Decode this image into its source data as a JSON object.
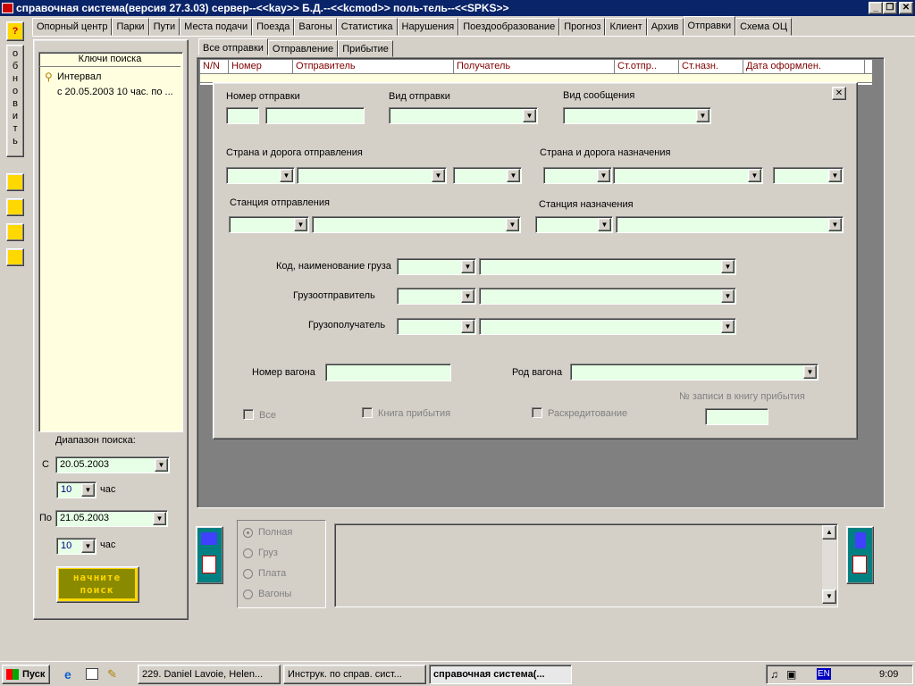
{
  "window": {
    "title": "справочная система(версия 27.3.03) сервер--<<kay>> Б.Д.--<<kcmod>> поль-тель--<<SPKS>>"
  },
  "tabs": [
    "Опорный центр",
    "Парки",
    "Пути",
    "Места подачи",
    "Поезда",
    "Вагоны",
    "Статистика",
    "Нарушения",
    "Поездообразование",
    "Прогноз",
    "Клиент",
    "Архив",
    "Отправки",
    "Схема ОЦ"
  ],
  "left_toolbar": {
    "help": "?",
    "refresh": "обновить"
  },
  "search_keys": {
    "header": "Ключи поиска",
    "item": "Интервал",
    "subitem": "с 20.05.2003   10 час.  по ..."
  },
  "range": {
    "title": "Диапазон поиска:",
    "from_label": "С",
    "from_date": "20.05.2003",
    "from_hour": "10",
    "to_label": "По",
    "to_date": "21.05.2003",
    "to_hour": "10",
    "hour_label": "час",
    "start_button": "начните поиск"
  },
  "subtabs": [
    "Все отправки",
    "Отправление",
    "Прибытие"
  ],
  "grid_columns": [
    "N/N",
    "Номер",
    "Отправитель",
    "Получатель",
    "Ст.отпр..",
    "Ст.назн.",
    "Дата оформлен."
  ],
  "dialog": {
    "close": "✕",
    "nomer": "Номер отправки",
    "vid_otpr": "Вид отправки",
    "vid_soob": "Вид сообщения",
    "strana_otpr": "Страна и дорога отправления",
    "strana_nazn": "Страна и дорога назначения",
    "st_otpr": "Станция отправления",
    "st_nazn": "Станция назначения",
    "gruz": "Код, наименование груза",
    "gruzootpr": "Грузоотправитель",
    "gruzopol": "Грузополучатель",
    "nomer_vag": "Номер вагона",
    "rod_vag": "Род вагона",
    "zapis": "№ записи в книгу прибытия",
    "vse": "Все",
    "kniga": "Книга прибытия",
    "raskred": "Раскредитование"
  },
  "bottom": {
    "opts": [
      "Полная",
      "Груз",
      "Плата",
      "Вагоны"
    ]
  },
  "taskbar": {
    "start": "Пуск",
    "tasks": [
      "229. Daniel Lavoie, Helen...",
      "Инструк. по справ. сист...",
      "справочная система(..."
    ],
    "lang": "EN",
    "time": "9:09"
  }
}
